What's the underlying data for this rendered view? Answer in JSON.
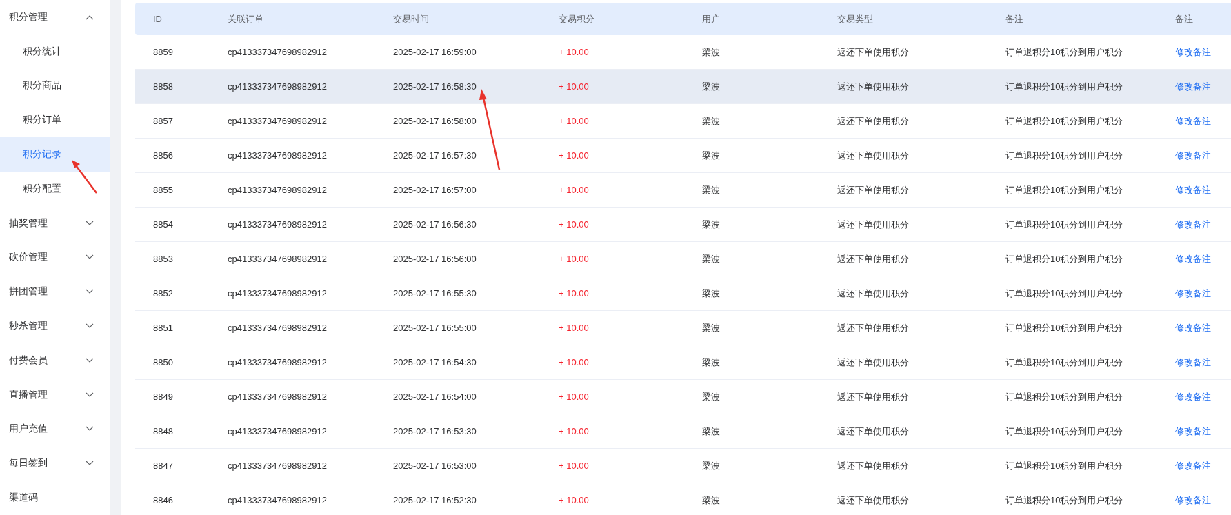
{
  "sidebar": {
    "items": [
      {
        "label": "积分管理",
        "kind": "group",
        "expanded": true,
        "children": [
          {
            "label": "积分统计",
            "selected": false
          },
          {
            "label": "积分商品",
            "selected": false
          },
          {
            "label": "积分订单",
            "selected": false
          },
          {
            "label": "积分记录",
            "selected": true
          },
          {
            "label": "积分配置",
            "selected": false
          }
        ]
      },
      {
        "label": "抽奖管理",
        "kind": "group",
        "expanded": false
      },
      {
        "label": "砍价管理",
        "kind": "group",
        "expanded": false
      },
      {
        "label": "拼团管理",
        "kind": "group",
        "expanded": false
      },
      {
        "label": "秒杀管理",
        "kind": "group",
        "expanded": false
      },
      {
        "label": "付费会员",
        "kind": "group",
        "expanded": false
      },
      {
        "label": "直播管理",
        "kind": "group",
        "expanded": false
      },
      {
        "label": "用户充值",
        "kind": "group",
        "expanded": false
      },
      {
        "label": "每日签到",
        "kind": "group",
        "expanded": false
      },
      {
        "label": "渠道码",
        "kind": "link"
      }
    ]
  },
  "table": {
    "columns": [
      "ID",
      "关联订单",
      "交易时间",
      "交易积分",
      "用户",
      "交易类型",
      "备注",
      "备注"
    ],
    "rows": [
      {
        "highlighted": false,
        "cells": [
          "8859",
          "cp413337347698982912",
          "2025-02-17 16:59:00",
          "+ 10.00",
          "梁波",
          "返还下单使用积分",
          "订单退积分10积分到用户积分",
          "修改备注"
        ]
      },
      {
        "highlighted": true,
        "cells": [
          "8858",
          "cp413337347698982912",
          "2025-02-17 16:58:30",
          "+ 10.00",
          "梁波",
          "返还下单使用积分",
          "订单退积分10积分到用户积分",
          "修改备注"
        ]
      },
      {
        "highlighted": false,
        "cells": [
          "8857",
          "cp413337347698982912",
          "2025-02-17 16:58:00",
          "+ 10.00",
          "梁波",
          "返还下单使用积分",
          "订单退积分10积分到用户积分",
          "修改备注"
        ]
      },
      {
        "highlighted": false,
        "cells": [
          "8856",
          "cp413337347698982912",
          "2025-02-17 16:57:30",
          "+ 10.00",
          "梁波",
          "返还下单使用积分",
          "订单退积分10积分到用户积分",
          "修改备注"
        ]
      },
      {
        "highlighted": false,
        "cells": [
          "8855",
          "cp413337347698982912",
          "2025-02-17 16:57:00",
          "+ 10.00",
          "梁波",
          "返还下单使用积分",
          "订单退积分10积分到用户积分",
          "修改备注"
        ]
      },
      {
        "highlighted": false,
        "cells": [
          "8854",
          "cp413337347698982912",
          "2025-02-17 16:56:30",
          "+ 10.00",
          "梁波",
          "返还下单使用积分",
          "订单退积分10积分到用户积分",
          "修改备注"
        ]
      },
      {
        "highlighted": false,
        "cells": [
          "8853",
          "cp413337347698982912",
          "2025-02-17 16:56:00",
          "+ 10.00",
          "梁波",
          "返还下单使用积分",
          "订单退积分10积分到用户积分",
          "修改备注"
        ]
      },
      {
        "highlighted": false,
        "cells": [
          "8852",
          "cp413337347698982912",
          "2025-02-17 16:55:30",
          "+ 10.00",
          "梁波",
          "返还下单使用积分",
          "订单退积分10积分到用户积分",
          "修改备注"
        ]
      },
      {
        "highlighted": false,
        "cells": [
          "8851",
          "cp413337347698982912",
          "2025-02-17 16:55:00",
          "+ 10.00",
          "梁波",
          "返还下单使用积分",
          "订单退积分10积分到用户积分",
          "修改备注"
        ]
      },
      {
        "highlighted": false,
        "cells": [
          "8850",
          "cp413337347698982912",
          "2025-02-17 16:54:30",
          "+ 10.00",
          "梁波",
          "返还下单使用积分",
          "订单退积分10积分到用户积分",
          "修改备注"
        ]
      },
      {
        "highlighted": false,
        "cells": [
          "8849",
          "cp413337347698982912",
          "2025-02-17 16:54:00",
          "+ 10.00",
          "梁波",
          "返还下单使用积分",
          "订单退积分10积分到用户积分",
          "修改备注"
        ]
      },
      {
        "highlighted": false,
        "cells": [
          "8848",
          "cp413337347698982912",
          "2025-02-17 16:53:30",
          "+ 10.00",
          "梁波",
          "返还下单使用积分",
          "订单退积分10积分到用户积分",
          "修改备注"
        ]
      },
      {
        "highlighted": false,
        "cells": [
          "8847",
          "cp413337347698982912",
          "2025-02-17 16:53:00",
          "+ 10.00",
          "梁波",
          "返还下单使用积分",
          "订单退积分10积分到用户积分",
          "修改备注"
        ]
      },
      {
        "highlighted": false,
        "cells": [
          "8846",
          "cp413337347698982912",
          "2025-02-17 16:52:30",
          "+ 10.00",
          "梁波",
          "返还下单使用积分",
          "订单退积分10积分到用户积分",
          "修改备注"
        ]
      }
    ]
  }
}
